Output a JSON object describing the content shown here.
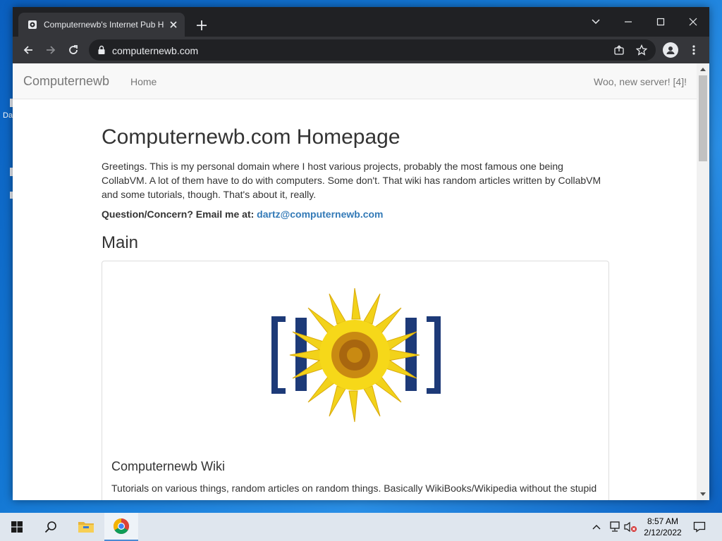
{
  "desktop": {
    "fragment_text": "Da"
  },
  "browser": {
    "tab_title": "Computernewb's Internet Pub H",
    "url": "computernewb.com"
  },
  "page": {
    "brand": "Computernewb",
    "nav_home": "Home",
    "nav_right": "Woo, new server! [4]!",
    "heading": "Computernewb.com Homepage",
    "intro": "Greetings. This is my personal domain where I host various projects, probably the most famous one being CollabVM. A lot of them have to do with computers. Some don't. That wiki has random articles written by CollabVM and some tutorials, though. That's about it, really.",
    "contact_label": "Question/Concern? Email me at:",
    "contact_email": "dartz@computernewb.com",
    "section_title": "Main",
    "card": {
      "logo_icon": "sunflower-logo",
      "title": "Computernewb Wiki",
      "text": "Tutorials on various things, random articles on random things. Basically WikiBooks/Wikipedia without the stupid"
    }
  },
  "taskbar": {
    "time": "8:57 AM",
    "date": "2/12/2022"
  },
  "colors": {
    "link": "#337ab7",
    "navbar_bg": "#f8f8f8",
    "chrome_dark": "#202124",
    "chrome_toolbar": "#35363a"
  }
}
